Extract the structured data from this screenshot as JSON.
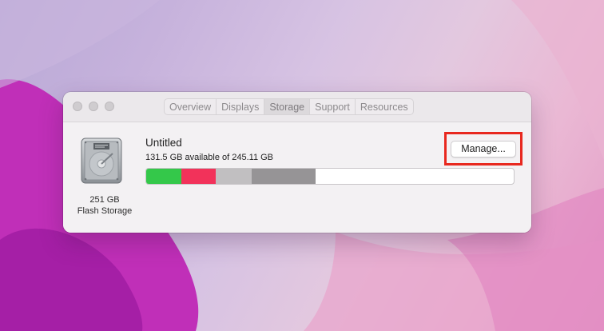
{
  "window": {
    "tabs": [
      {
        "label": "Overview",
        "active": false
      },
      {
        "label": "Displays",
        "active": false
      },
      {
        "label": "Storage",
        "active": true
      },
      {
        "label": "Support",
        "active": false
      },
      {
        "label": "Resources",
        "active": false
      }
    ]
  },
  "storage": {
    "disk_icon": "hard-drive-icon",
    "disk_size": "251 GB",
    "disk_type": "Flash Storage",
    "volume_name": "Untitled",
    "available_text": "131.5 GB available of 245.11 GB",
    "manage_label": "Manage...",
    "usage_segments_fraction": [
      {
        "color": "#34c84a",
        "fraction": 0.0955
      },
      {
        "color": "#f2325a",
        "fraction": 0.0935
      },
      {
        "color": "#c1bfc1",
        "fraction": 0.0975
      },
      {
        "color": "#969496",
        "fraction": 0.1735
      }
    ]
  },
  "highlight": {
    "target": "manage-button",
    "color": "#e8281f"
  }
}
